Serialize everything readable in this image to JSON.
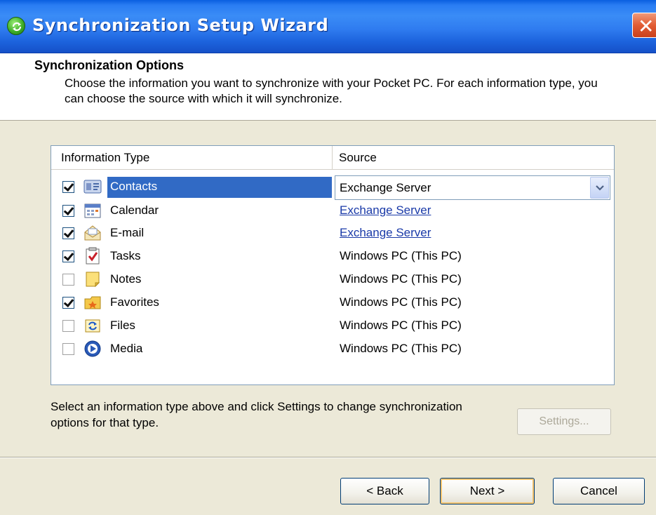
{
  "window": {
    "title": "Synchronization Setup Wizard",
    "close_label": "✕"
  },
  "header": {
    "title": "Synchronization Options",
    "description": "Choose the information you want to synchronize with your Pocket PC.  For each information type, you can choose the source with which it will synchronize."
  },
  "table": {
    "columns": [
      "Information Type",
      "Source"
    ],
    "rows": [
      {
        "label": "Contacts",
        "checked": true,
        "icon": "contacts-icon",
        "source": "Exchange Server",
        "source_style": "dropdown",
        "selected": true
      },
      {
        "label": "Calendar",
        "checked": true,
        "icon": "calendar-icon",
        "source": "Exchange Server",
        "source_style": "link",
        "selected": false
      },
      {
        "label": "E-mail",
        "checked": true,
        "icon": "email-icon",
        "source": "Exchange Server",
        "source_style": "link",
        "selected": false
      },
      {
        "label": "Tasks",
        "checked": true,
        "icon": "tasks-icon",
        "source": "Windows PC (This PC)",
        "source_style": "text",
        "selected": false
      },
      {
        "label": "Notes",
        "checked": false,
        "icon": "notes-icon",
        "source": "Windows PC (This PC)",
        "source_style": "text",
        "selected": false
      },
      {
        "label": "Favorites",
        "checked": true,
        "icon": "favorites-icon",
        "source": "Windows PC (This PC)",
        "source_style": "text",
        "selected": false
      },
      {
        "label": "Files",
        "checked": false,
        "icon": "files-icon",
        "source": "Windows PC (This PC)",
        "source_style": "text",
        "selected": false
      },
      {
        "label": "Media",
        "checked": false,
        "icon": "media-icon",
        "source": "Windows PC (This PC)",
        "source_style": "text",
        "selected": false
      }
    ]
  },
  "hint": "Select an information type above and click Settings to change synchronization options for that type.",
  "buttons": {
    "settings": "Settings...",
    "back": "< Back",
    "next": "Next >",
    "cancel": "Cancel"
  },
  "colors": {
    "titlebar": "#2f7cf0",
    "selection": "#316ac5",
    "link": "#1a3aa8",
    "dialog_bg": "#ece9d8"
  }
}
